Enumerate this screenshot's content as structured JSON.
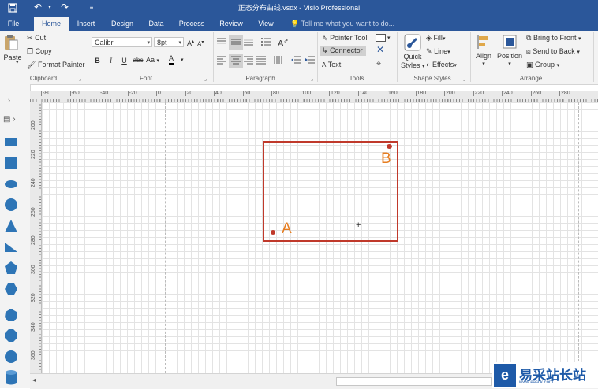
{
  "window": {
    "title": "正态分布曲线.vsdx - Visio Professional"
  },
  "quick_access": {
    "save_icon": "save-icon",
    "undo_icon": "undo-icon",
    "redo_icon": "redo-icon",
    "customize_icon": "customize-icon"
  },
  "tabs": [
    {
      "label": "File"
    },
    {
      "label": "Home"
    },
    {
      "label": "Insert"
    },
    {
      "label": "Design"
    },
    {
      "label": "Data"
    },
    {
      "label": "Process"
    },
    {
      "label": "Review"
    },
    {
      "label": "View"
    }
  ],
  "tell_me": {
    "placeholder": "Tell me what you want to do..."
  },
  "ribbon": {
    "clipboard": {
      "paste": "Paste",
      "cut": "Cut",
      "copy": "Copy",
      "format_painter": "Format Painter",
      "group": "Clipboard"
    },
    "font": {
      "family": "Calibri",
      "size": "8pt",
      "bold": "B",
      "italic": "I",
      "underline": "U",
      "strike": "abc",
      "case": "Aa",
      "color": "A",
      "grow": "A",
      "shrink": "A",
      "group": "Font"
    },
    "paragraph": {
      "group": "Paragraph"
    },
    "tools": {
      "pointer": "Pointer Tool",
      "connector": "Connector",
      "text": "Text",
      "group": "Tools"
    },
    "shape_styles": {
      "quick_styles_1": "Quick",
      "quick_styles_2": "Styles",
      "fill": "Fill",
      "line": "Line",
      "effects": "Effects",
      "group": "Shape Styles"
    },
    "arrange": {
      "align": "Align",
      "position": "Position",
      "bring_front": "Bring to Front",
      "send_back": "Send to Back",
      "group_btn": "Group",
      "group": "Arrange"
    }
  },
  "ruler": {
    "h_ticks": [
      "-80",
      "-60",
      "-40",
      "-20",
      "0",
      "20",
      "40",
      "60",
      "80",
      "100",
      "120",
      "140",
      "160",
      "180",
      "200",
      "220",
      "240",
      "260",
      "280"
    ],
    "v_ticks": [
      "200",
      "220",
      "240",
      "260",
      "280",
      "300",
      "320",
      "340",
      "360"
    ]
  },
  "canvas": {
    "label_a": "A",
    "label_b": "B",
    "rect_color": "#c0392b",
    "label_color": "#e67e22"
  },
  "watermark": {
    "name": "易采站长站",
    "url": "www.easck.com"
  }
}
